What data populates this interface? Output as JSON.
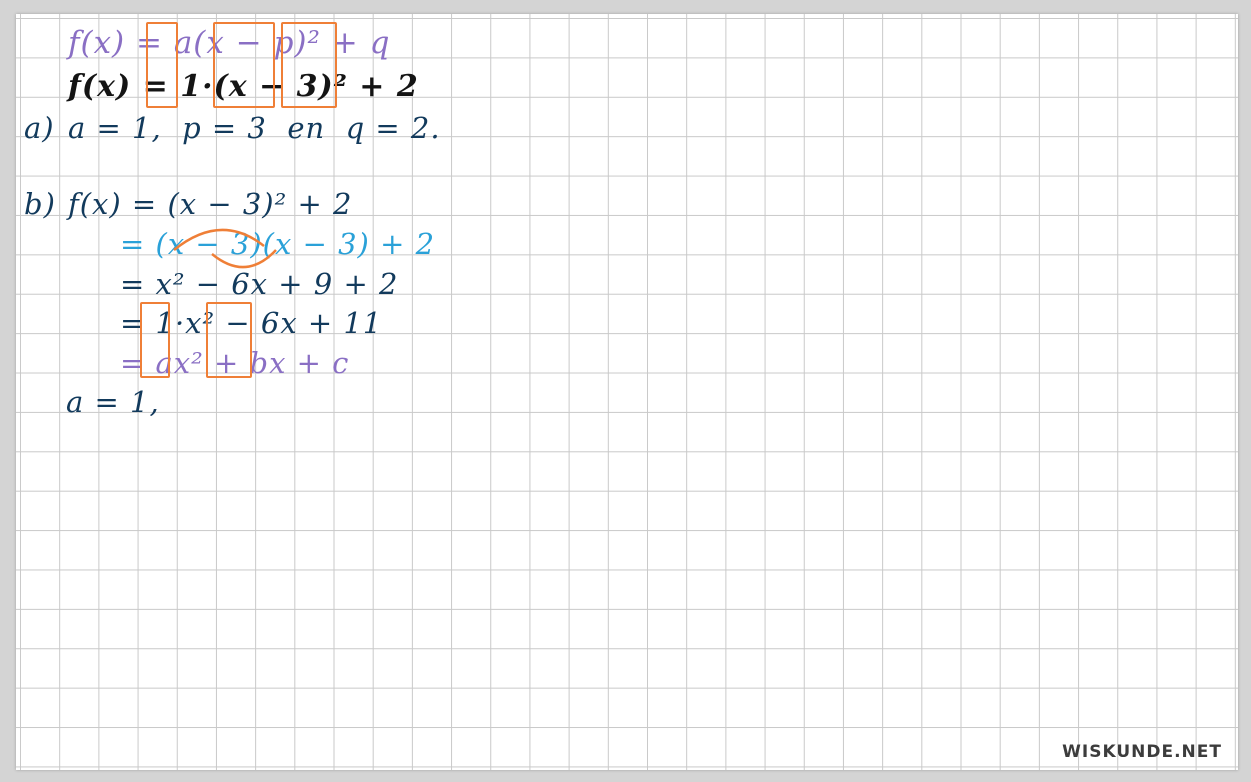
{
  "brand": {
    "name": "WISKUNDE.NET"
  },
  "board": {
    "line1": "f(x) = a(x − p)² + q",
    "line2": "f(x) = 1·(x − 3)² + 2",
    "part_a": {
      "label": "a)",
      "text": "a = 1,  p = 3  en  q = 2."
    },
    "part_b": {
      "label": "b)",
      "line1": "f(x) = (x − 3)² + 2",
      "line2": "= (x − 3)(x − 3) + 2",
      "line3": "= x² − 6x + 9 + 2",
      "line4": "= 1·x² − 6x + 11",
      "line5": "= ax² + bx + c"
    },
    "answer": "a = 1,"
  },
  "colors": {
    "grid": "#c9c9c9",
    "purple": "#8a6fc4",
    "navy": "#123a5c",
    "cyan": "#2aa1d8",
    "orange": "#f07a2e",
    "black": "#141414"
  }
}
